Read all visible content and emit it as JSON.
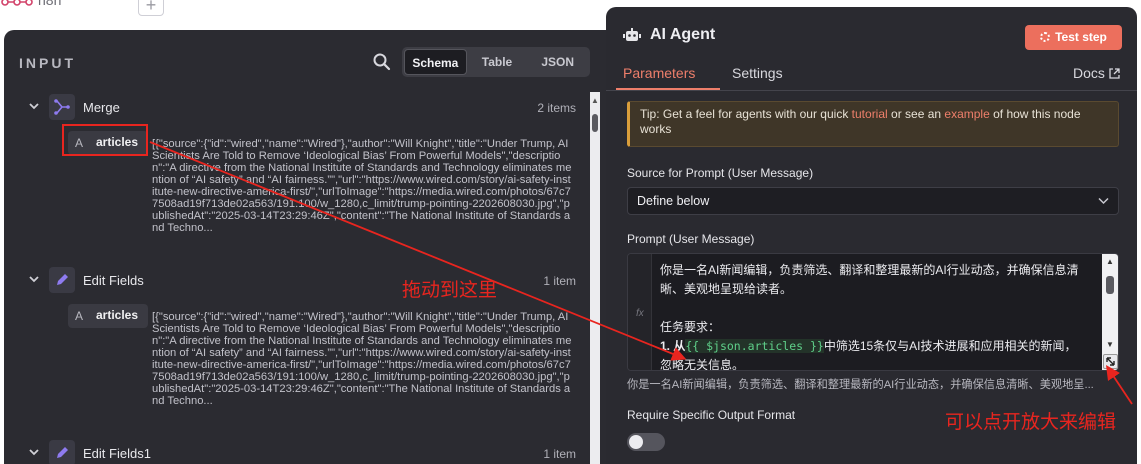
{
  "canvas": {
    "title_fragment": "n8n",
    "add_label": "+"
  },
  "input_panel": {
    "title": "INPUT",
    "view_tabs": [
      "Schema",
      "Table",
      "JSON"
    ],
    "active_tab": "Schema",
    "nodes": [
      {
        "name": "Merge",
        "count": "2 items",
        "icon": "merge-icon",
        "field": {
          "type": "A",
          "key": "articles",
          "value": "[{\"source\":{\"id\":\"wired\",\"name\":\"Wired\"},\"author\":\"Will Knight\",\"title\":\"Under Trump, AI Scientists Are Told to Remove ‘Ideological Bias’ From Powerful Models\",\"description\":\"A directive from the National Institute of Standards and Technology eliminates mention of “AI safety” and “AI fairness.”\",\"url\":\"https://www.wired.com/story/ai-safety-institute-new-directive-america-first/\",\"urlToImage\":\"https://media.wired.com/photos/67c77508ad19f713de02a563/191:100/w_1280,c_limit/trump-pointing-2202608030.jpg\",\"publishedAt\":\"2025-03-14T23:29:46Z\",\"content\":\"The National Institute of Standards and Techno..."
        }
      },
      {
        "name": "Edit Fields",
        "count": "1 item",
        "icon": "pencil-icon",
        "field": {
          "type": "A",
          "key": "articles",
          "value": "[{\"source\":{\"id\":\"wired\",\"name\":\"Wired\"},\"author\":\"Will Knight\",\"title\":\"Under Trump, AI Scientists Are Told to Remove ‘Ideological Bias’ From Powerful Models\",\"description\":\"A directive from the National Institute of Standards and Technology eliminates mention of “AI safety” and “AI fairness.”\",\"url\":\"https://www.wired.com/story/ai-safety-institute-new-directive-america-first/\",\"urlToImage\":\"https://media.wired.com/photos/67c77508ad19f713de02a563/191:100/w_1280,c_limit/trump-pointing-2202608030.jpg\",\"publishedAt\":\"2025-03-14T23:29:46Z\",\"content\":\"The National Institute of Standards and Techno..."
        }
      },
      {
        "name": "Edit Fields1",
        "count": "1 item",
        "icon": "pencil-icon"
      }
    ]
  },
  "agent_panel": {
    "title": "AI Agent",
    "test_button": "Test step",
    "tabs": {
      "parameters": "Parameters",
      "settings": "Settings",
      "docs": "Docs"
    },
    "tip": {
      "prefix": "Tip: Get a feel for agents with our quick ",
      "link1": "tutorial",
      "middle": " or see an ",
      "link2": "example",
      "suffix": " of how this node works"
    },
    "source_label": "Source for Prompt (User Message)",
    "source_value": "Define below",
    "prompt_label": "Prompt (User Message)",
    "fx_label": "fx",
    "prompt_lines": {
      "line1": "你是一名AI新闻编辑，负责筛选、翻译和整理最新的AI行业动态，并确保信息清晰、美观地呈现给读者。",
      "line2": "任务要求：",
      "line3_num": "1. 从",
      "line3_expr": "{{ $json.articles }}",
      "line3_rest": "中筛选15条仅与AI技术进展和应用相关的新闻，",
      "line4": "忽略无关信息。"
    },
    "preview": "你是一名AI新闻编辑，负责筛选、翻译和整理最新的AI行业动态，并确保信息清晰、美观地呈...",
    "require_format_label": "Require Specific Output Format",
    "require_format_on": false
  },
  "annotations": {
    "drag_here": "拖动到这里",
    "click_expand": "可以点开放大来编辑"
  },
  "colors": {
    "accent": "#ee7f6b",
    "annotation": "#e8251f",
    "panel_bg": "#2a2a30",
    "expression": "#5fd08a"
  }
}
